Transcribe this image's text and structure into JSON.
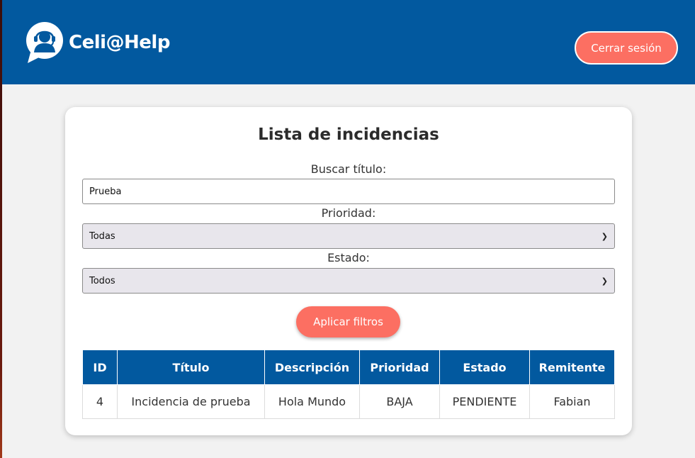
{
  "header": {
    "brand": "Celi@Help",
    "logout_label": "Cerrar sesión",
    "logo_icon": "headset-support-icon",
    "background_color": "#02599f",
    "accent_color": "#fc6f62"
  },
  "main": {
    "title": "Lista de incidencias",
    "search": {
      "label": "Buscar título:",
      "value": "Prueba"
    },
    "priority": {
      "label": "Prioridad:",
      "selected": "Todas"
    },
    "status": {
      "label": "Estado:",
      "selected": "Todos"
    },
    "apply_label": "Aplicar filtros",
    "table": {
      "columns": [
        "ID",
        "Título",
        "Descripción",
        "Prioridad",
        "Estado",
        "Remitente"
      ],
      "rows": [
        [
          "4",
          "Incidencia de prueba",
          "Hola Mundo",
          "BAJA",
          "PENDIENTE",
          "Fabian"
        ]
      ]
    }
  }
}
